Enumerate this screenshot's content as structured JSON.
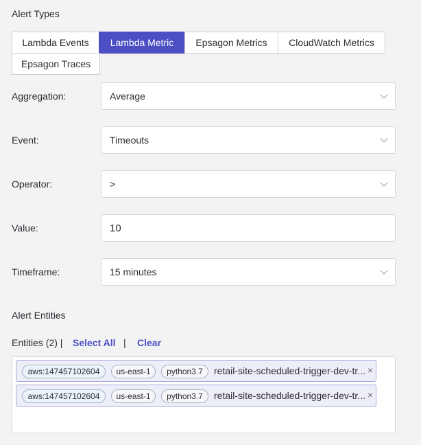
{
  "alert_types": {
    "title": "Alert Types",
    "tabs": [
      {
        "label": "Lambda Events",
        "active": false
      },
      {
        "label": "Lambda Metric",
        "active": true
      },
      {
        "label": "Epsagon Metrics",
        "active": false
      },
      {
        "label": "CloudWatch Metrics",
        "active": false
      },
      {
        "label": "Epsagon Traces",
        "active": false
      }
    ]
  },
  "form": {
    "aggregation": {
      "label": "Aggregation:",
      "value": "Average"
    },
    "event": {
      "label": "Event:",
      "value": "Timeouts"
    },
    "operator": {
      "label": "Operator:",
      "value": ">"
    },
    "value": {
      "label": "Value:",
      "value": "10"
    },
    "timeframe": {
      "label": "Timeframe:",
      "value": "15 minutes"
    }
  },
  "alert_entities": {
    "title": "Alert Entities",
    "count_label": "Entities (2) |",
    "select_all": "Select All",
    "separator": "|",
    "clear": "Clear",
    "items": [
      {
        "account": "aws:147457102604",
        "region": "us-east-1",
        "runtime": "python3.7",
        "name": "retail-site-scheduled-trigger-dev-tr..."
      },
      {
        "account": "aws:147457102604",
        "region": "us-east-1",
        "runtime": "python3.7",
        "name": "retail-site-scheduled-trigger-dev-tr..."
      }
    ]
  },
  "colors": {
    "accent": "#4c4fc3",
    "background": "#f3f3f4"
  },
  "icons": {
    "dropdown": "chevron-down-icon",
    "remove": "close-icon"
  }
}
